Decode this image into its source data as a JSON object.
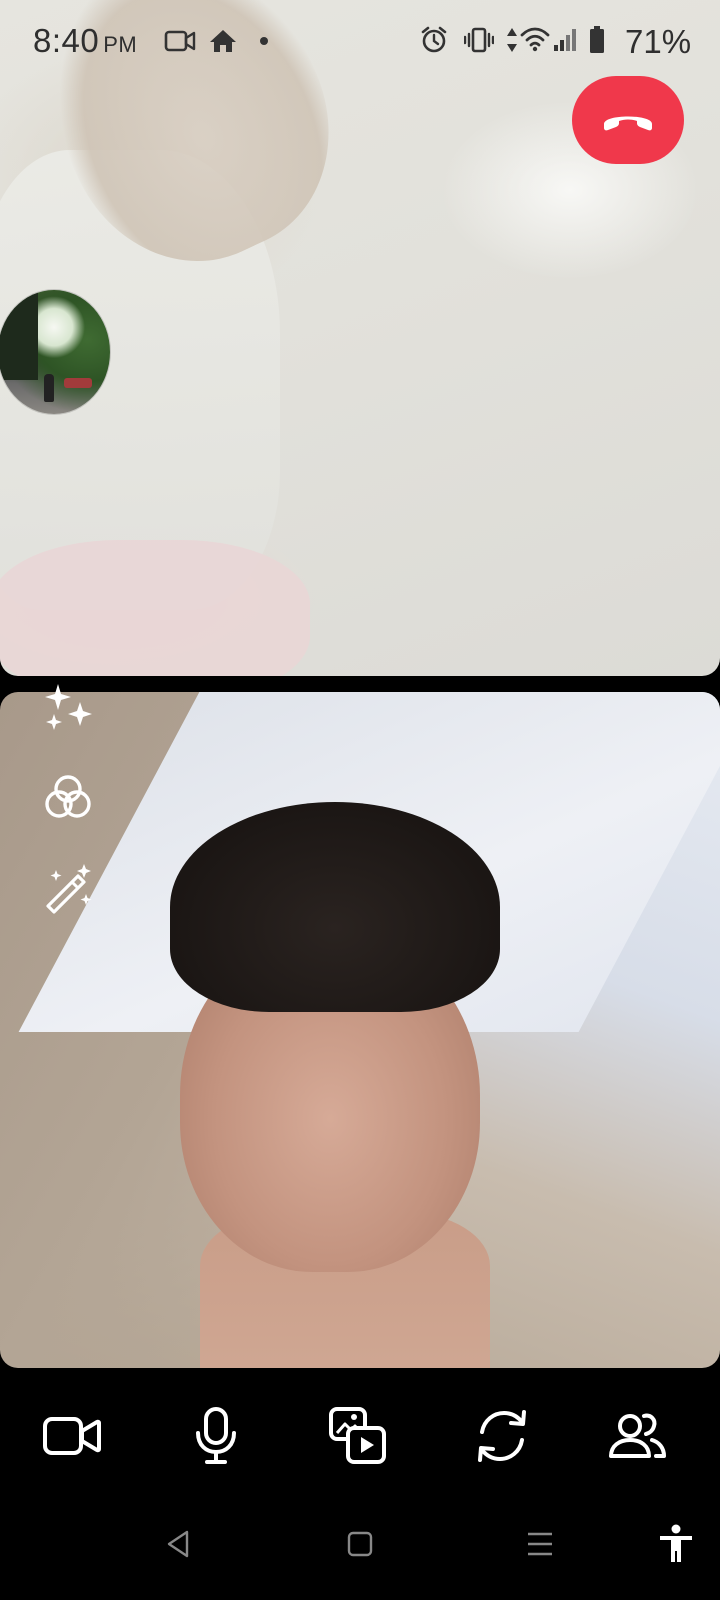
{
  "status_bar": {
    "time": "8:40",
    "ampm": "PM",
    "battery_percent": "71%",
    "icons": [
      "video-recording-icon",
      "home-icon",
      "dot-icon",
      "alarm-icon",
      "vibrate-icon",
      "data-arrows-icon",
      "wifi-icon",
      "signal-icon",
      "battery-icon"
    ]
  },
  "call": {
    "end_call_icon": "end-call-icon",
    "end_call_color": "#f0384b"
  },
  "effects": {
    "items": [
      "sparkles-icon",
      "filters-icon",
      "magic-wand-icon"
    ]
  },
  "controls": {
    "items": [
      "camera-icon",
      "microphone-icon",
      "share-media-icon",
      "flip-camera-icon",
      "participants-icon"
    ]
  },
  "navigation": {
    "items": [
      "back-icon",
      "home-nav-icon",
      "recents-icon",
      "accessibility-icon"
    ]
  }
}
